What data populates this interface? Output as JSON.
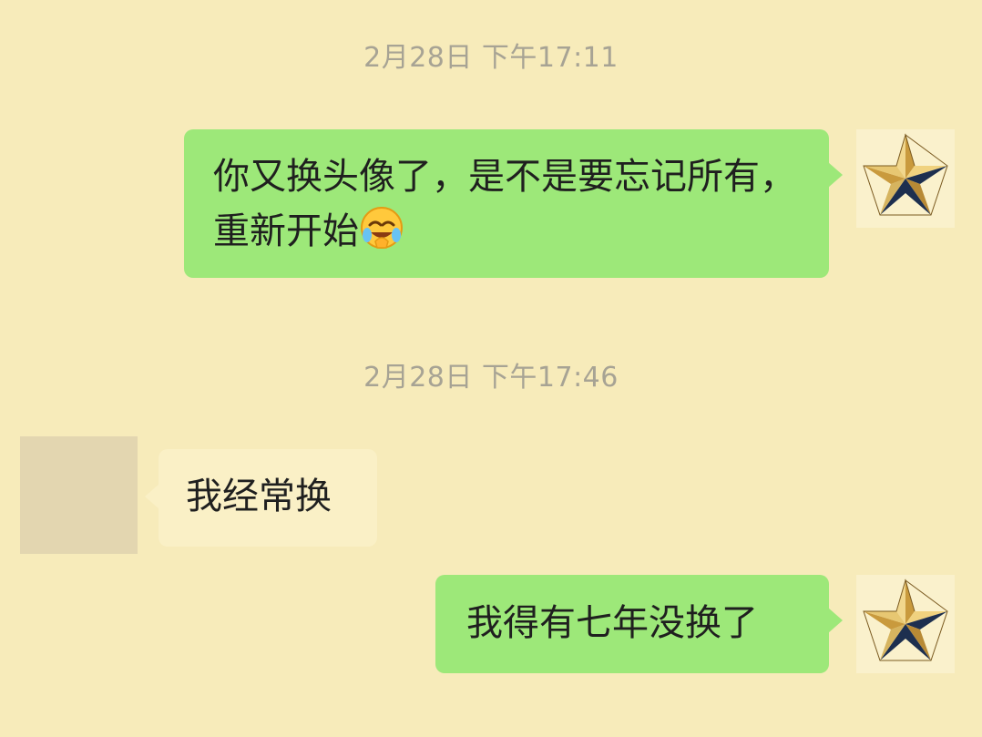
{
  "messages": [
    {
      "timestamp": "2月28日 下午17:11",
      "direction": "outgoing",
      "text": "你又换头像了，是不是要忘记所有，重新开始",
      "emoji": "face-with-tears-of-joy-covering-eyes"
    },
    {
      "timestamp": "2月28日 下午17:46",
      "direction": "incoming",
      "text": "我经常换"
    },
    {
      "direction": "outgoing",
      "text": "我得有七年没换了"
    }
  ],
  "avatars": {
    "me": {
      "icon": "gold-navy-star-icon"
    },
    "them": {
      "icon": "blank-avatar"
    }
  },
  "colors": {
    "background": "#f7ebba",
    "outgoing_bubble": "#9de879",
    "incoming_bubble": "#faf0c6",
    "timestamp_text": "#a7a394",
    "star_gold": "#d6b45f",
    "star_navy": "#1d2f4f"
  }
}
